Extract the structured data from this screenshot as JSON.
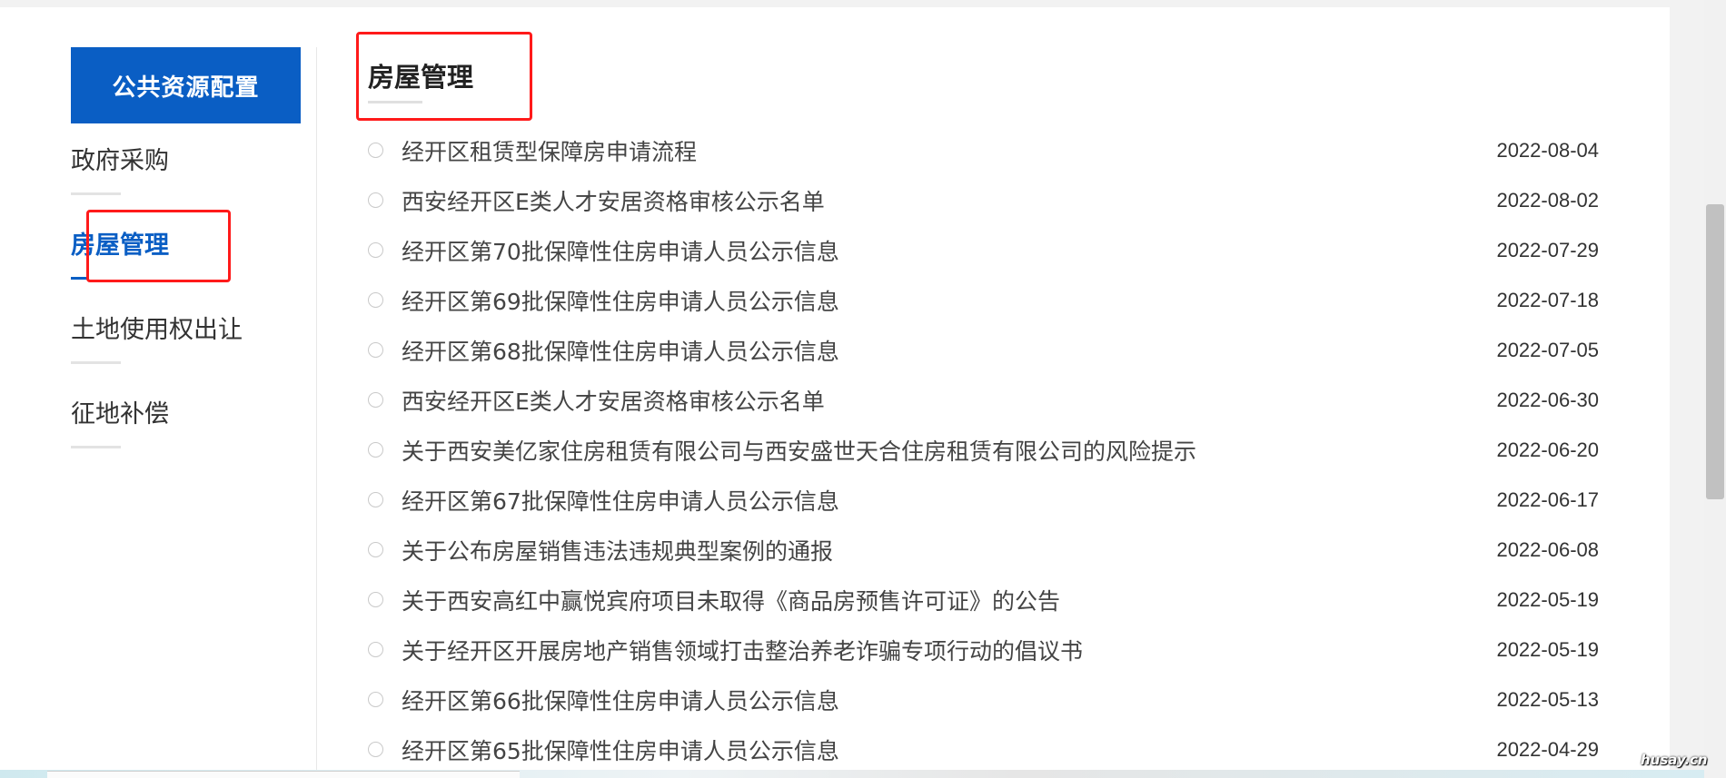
{
  "sidebar": {
    "header": "公共资源配置",
    "items": [
      {
        "label": "政府采购",
        "active": false
      },
      {
        "label": "房屋管理",
        "active": true
      },
      {
        "label": "土地使用权出让",
        "active": false
      },
      {
        "label": "征地补偿",
        "active": false
      }
    ]
  },
  "main": {
    "title": "房屋管理",
    "news": [
      {
        "title": "经开区租赁型保障房申请流程",
        "date": "2022-08-04"
      },
      {
        "title": "西安经开区E类人才安居资格审核公示名单",
        "date": "2022-08-02"
      },
      {
        "title": "经开区第70批保障性住房申请人员公示信息",
        "date": "2022-07-29"
      },
      {
        "title": "经开区第69批保障性住房申请人员公示信息",
        "date": "2022-07-18"
      },
      {
        "title": "经开区第68批保障性住房申请人员公示信息",
        "date": "2022-07-05"
      },
      {
        "title": "西安经开区E类人才安居资格审核公示名单",
        "date": "2022-06-30"
      },
      {
        "title": "关于西安美亿家住房租赁有限公司与西安盛世天合住房租赁有限公司的风险提示",
        "date": "2022-06-20"
      },
      {
        "title": "经开区第67批保障性住房申请人员公示信息",
        "date": "2022-06-17"
      },
      {
        "title": "关于公布房屋销售违法违规典型案例的通报",
        "date": "2022-06-08"
      },
      {
        "title": "关于西安高红中赢悦宾府项目未取得《商品房预售许可证》的公告",
        "date": "2022-05-19"
      },
      {
        "title": "关于经开区开展房地产销售领域打击整治养老诈骗专项行动的倡议书",
        "date": "2022-05-19"
      },
      {
        "title": "经开区第66批保障性住房申请人员公示信息",
        "date": "2022-05-13"
      },
      {
        "title": "经开区第65批保障性住房申请人员公示信息",
        "date": "2022-04-29"
      }
    ]
  },
  "watermark": "husay.cn",
  "colors": {
    "accent": "#0a5ec4",
    "highlight_box": "#ff1a1a"
  }
}
